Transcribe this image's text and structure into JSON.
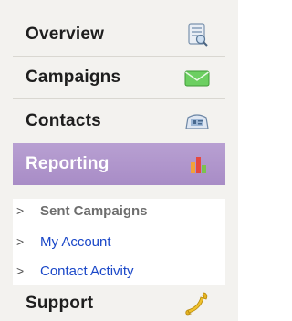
{
  "nav": {
    "items": [
      {
        "label": "Overview",
        "icon": "overview-document-icon"
      },
      {
        "label": "Campaigns",
        "icon": "envelope-icon"
      },
      {
        "label": "Contacts",
        "icon": "address-card-icon"
      },
      {
        "label": "Reporting",
        "icon": "bar-chart-icon",
        "active": true
      },
      {
        "label": "Support",
        "icon": "phone-handset-icon"
      }
    ],
    "sub_items": [
      {
        "label": "Sent Campaigns",
        "current": true
      },
      {
        "label": "My Account"
      },
      {
        "label": "Contact Activity"
      }
    ],
    "chevron": ">",
    "colors": {
      "active_bg": "#ae95cc",
      "link": "#1a47c8",
      "current_sub": "#6e6e6e",
      "panel_bg": "#f3f2ef"
    }
  }
}
